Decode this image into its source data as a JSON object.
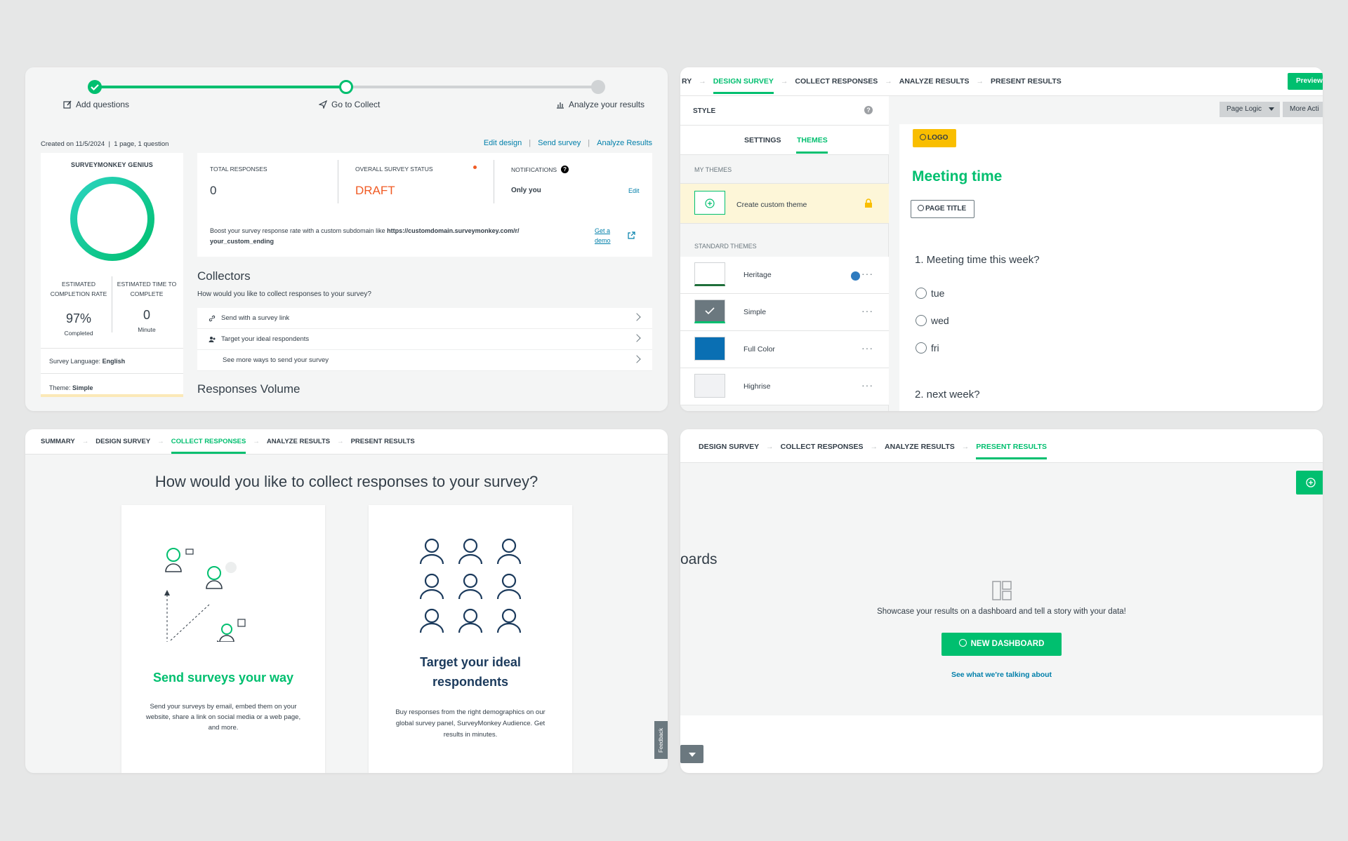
{
  "summary": {
    "steps": [
      {
        "label": "Add questions"
      },
      {
        "label": "Go to Collect"
      },
      {
        "label": "Analyze your results"
      }
    ],
    "meta": "Created on 11/5/2024  |  1 page, 1 question",
    "links": [
      "Edit design",
      "Send survey",
      "Analyze Results"
    ],
    "genius": {
      "title": "SURVEYMONKEY GENIUS",
      "completion_label": "ESTIMATED COMPLETION RATE",
      "completion_value": "97%",
      "completion_unit": "Completed",
      "time_label": "ESTIMATED TIME TO COMPLETE",
      "time_value": "0",
      "time_unit": "Minute",
      "language_label": "Survey Language:",
      "language_value": "English",
      "theme_label": "Theme:",
      "theme_value": "Simple"
    },
    "stats": {
      "total_label": "TOTAL RESPONSES",
      "total_value": "0",
      "status_label": "OVERALL SURVEY STATUS",
      "status_value": "DRAFT",
      "notif_label": "NOTIFICATIONS",
      "notif_value": "Only you",
      "notif_edit": "Edit",
      "boost_text": "Boost your survey response rate with a custom subdomain like",
      "boost_url": "https://customdomain.surveymonkey.com/r/",
      "boost_url2": "your_custom_ending",
      "demo_link": "Get a",
      "demo_link2": "demo"
    },
    "collectors": {
      "title": "Collectors",
      "subtitle": "How would you like to collect responses to your survey?",
      "rows": [
        "Send with a survey link",
        "Target your ideal respondents",
        "See more ways to send your survey"
      ]
    },
    "volume_title": "Responses Volume"
  },
  "design": {
    "nav": [
      "RY",
      "DESIGN SURVEY",
      "COLLECT RESPONSES",
      "ANALYZE RESULTS",
      "PRESENT RESULTS"
    ],
    "preview": "Preview",
    "style_label": "STYLE",
    "tabs": [
      "SETTINGS",
      "THEMES"
    ],
    "my_themes": "MY THEMES",
    "create_theme": "Create custom theme",
    "standard_themes": "STANDARD THEMES",
    "themes": [
      "Heritage",
      "Simple",
      "Full Color",
      "Highrise"
    ],
    "page_logic": "Page Logic",
    "more_actions": "More Acti",
    "logo_btn": "LOGO",
    "survey_title": "Meeting time",
    "page_title_btn": "PAGE TITLE",
    "question1": "1. Meeting time this week?",
    "options": [
      "tue",
      "wed",
      "fri"
    ],
    "question2": "2. next week?",
    "colors": {
      "accent": "#00bf6f",
      "logo": "#f9be00"
    }
  },
  "collect": {
    "nav": [
      "SUMMARY",
      "DESIGN SURVEY",
      "COLLECT RESPONSES",
      "ANALYZE RESULTS",
      "PRESENT RESULTS"
    ],
    "heading": "How would you like to collect responses to your survey?",
    "card1_title": "Send surveys your way",
    "card1_desc": "Send your surveys by email, embed them on your website, share a link on social media or a web page, and more.",
    "card2_title1": "Target your ideal",
    "card2_title2": "respondents",
    "card2_desc": "Buy responses from the right demographics on our global survey panel, SurveyMonkey Audience. Get results in minutes.",
    "feedback": "Feedback"
  },
  "present": {
    "nav": [
      "DESIGN SURVEY",
      "COLLECT RESPONSES",
      "ANALYZE RESULTS",
      "PRESENT RESULTS"
    ],
    "dashboards": "oards",
    "message": "Showcase your results on a dashboard and tell a story with your data!",
    "new_dashboard": "NEW DASHBOARD",
    "see_link": "See what we're talking about"
  }
}
